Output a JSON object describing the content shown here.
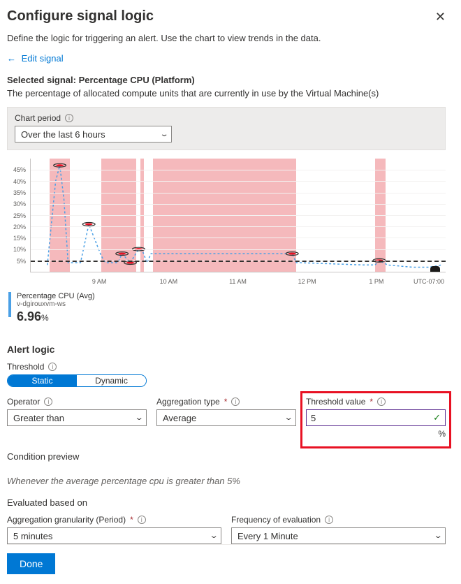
{
  "header": {
    "title": "Configure signal logic",
    "subtitle": "Define the logic for triggering an alert. Use the chart to view trends in the data.",
    "back_link": "Edit signal"
  },
  "selected_signal": {
    "label": "Selected signal: Percentage CPU (Platform)",
    "description": "The percentage of allocated compute units that are currently in use by the Virtual Machine(s)"
  },
  "chart_period": {
    "label": "Chart period",
    "value": "Over the last 6 hours"
  },
  "legend": {
    "metric": "Percentage CPU (Avg)",
    "resource": "v-dgirouxvm-ws",
    "value": "6.96",
    "unit": "%"
  },
  "alert_logic": {
    "title": "Alert logic",
    "threshold_label": "Threshold",
    "threshold_toggle": {
      "static": "Static",
      "dynamic": "Dynamic"
    },
    "operator_label": "Operator",
    "operator_value": "Greater than",
    "aggregation_label": "Aggregation type",
    "aggregation_value": "Average",
    "threshold_value_label": "Threshold value",
    "threshold_value": "5",
    "threshold_unit": "%",
    "preview_label": "Condition preview",
    "preview_text": "Whenever the average percentage cpu is greater than 5%"
  },
  "evaluated": {
    "title": "Evaluated based on",
    "granularity_label": "Aggregation granularity (Period)",
    "granularity_value": "5 minutes",
    "frequency_label": "Frequency of evaluation",
    "frequency_value": "Every 1 Minute"
  },
  "footer": {
    "done": "Done"
  },
  "chart_data": {
    "type": "line",
    "title": "Percentage CPU (Avg)",
    "ylabel": "%",
    "ylim": [
      0,
      50
    ],
    "y_ticks": [
      5,
      10,
      15,
      20,
      25,
      30,
      35,
      40,
      45
    ],
    "x_ticks": [
      "9 AM",
      "10 AM",
      "11 AM",
      "12 PM",
      "1 PM"
    ],
    "timezone": "UTC-07:00",
    "threshold": 5,
    "series": [
      {
        "name": "Percentage CPU (Avg)",
        "x_pct": [
          4,
          6,
          7,
          8,
          9,
          10,
          12,
          14,
          17,
          18,
          21,
          22,
          24,
          26,
          27,
          28,
          29,
          30,
          34,
          40,
          48,
          55,
          63,
          64,
          65,
          80,
          82,
          83,
          84,
          86,
          92,
          96,
          99
        ],
        "y_val": [
          3,
          40,
          47,
          32,
          4,
          4,
          4,
          21,
          7,
          4,
          4,
          8,
          4,
          10,
          9,
          4,
          8,
          8,
          8,
          8,
          8,
          8,
          8,
          4,
          4,
          3,
          3,
          3,
          5,
          3,
          2,
          2,
          3
        ]
      }
    ],
    "markers": [
      {
        "x_pct": 7,
        "y_val": 47
      },
      {
        "x_pct": 14,
        "y_val": 21
      },
      {
        "x_pct": 22,
        "y_val": 8
      },
      {
        "x_pct": 24,
        "y_val": 4
      },
      {
        "x_pct": 26,
        "y_val": 10
      },
      {
        "x_pct": 63,
        "y_val": 8
      },
      {
        "x_pct": 84,
        "y_val": 5
      }
    ],
    "bands_pct": [
      [
        4.5,
        9.5
      ],
      [
        17,
        25.5
      ],
      [
        26.5,
        27.2
      ],
      [
        29.5,
        64
      ],
      [
        83,
        85.5
      ]
    ]
  }
}
